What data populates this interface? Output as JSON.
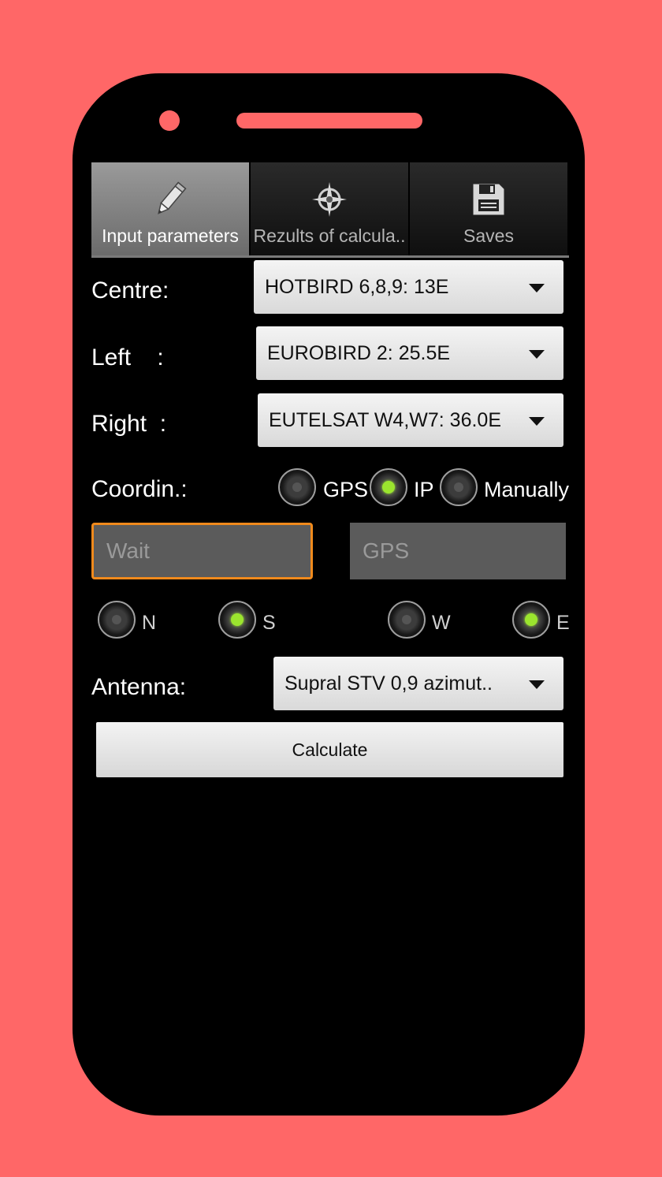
{
  "tabs": [
    {
      "label": "Input parameters",
      "icon": "pencil-icon",
      "active": true
    },
    {
      "label": "Rezults of calcula..",
      "icon": "compass-icon",
      "active": false
    },
    {
      "label": "Saves",
      "icon": "floppy-disk-icon",
      "active": false
    }
  ],
  "form": {
    "centre": {
      "label": "Centre:",
      "value": "HOTBIRD 6,8,9: 13E"
    },
    "left": {
      "label": "Left    :",
      "value": "EUROBIRD 2: 25.5E"
    },
    "right": {
      "label": "Right  :",
      "value": "EUTELSAT W4,W7: 36.0E"
    },
    "coordinates": {
      "label": "Coordin.:",
      "options": [
        {
          "label": "GPS",
          "selected": false
        },
        {
          "label": "IP",
          "selected": true
        },
        {
          "label": "Manually",
          "selected": false
        }
      ]
    },
    "latitude_field": {
      "placeholder": "Wait"
    },
    "longitude_field": {
      "placeholder": "GPS"
    },
    "hemisphere": {
      "ns": [
        {
          "label": "N",
          "selected": false
        },
        {
          "label": "S",
          "selected": true
        }
      ],
      "we": [
        {
          "label": "W",
          "selected": false
        },
        {
          "label": "E",
          "selected": true
        }
      ]
    },
    "antenna": {
      "label": "Antenna:",
      "value": "Supral STV 0,9 azimut.."
    },
    "calculate_label": "Calculate"
  },
  "colors": {
    "background": "#ff6767",
    "accent_focus": "#f08a1c",
    "radio_selected": "#9be52e"
  }
}
